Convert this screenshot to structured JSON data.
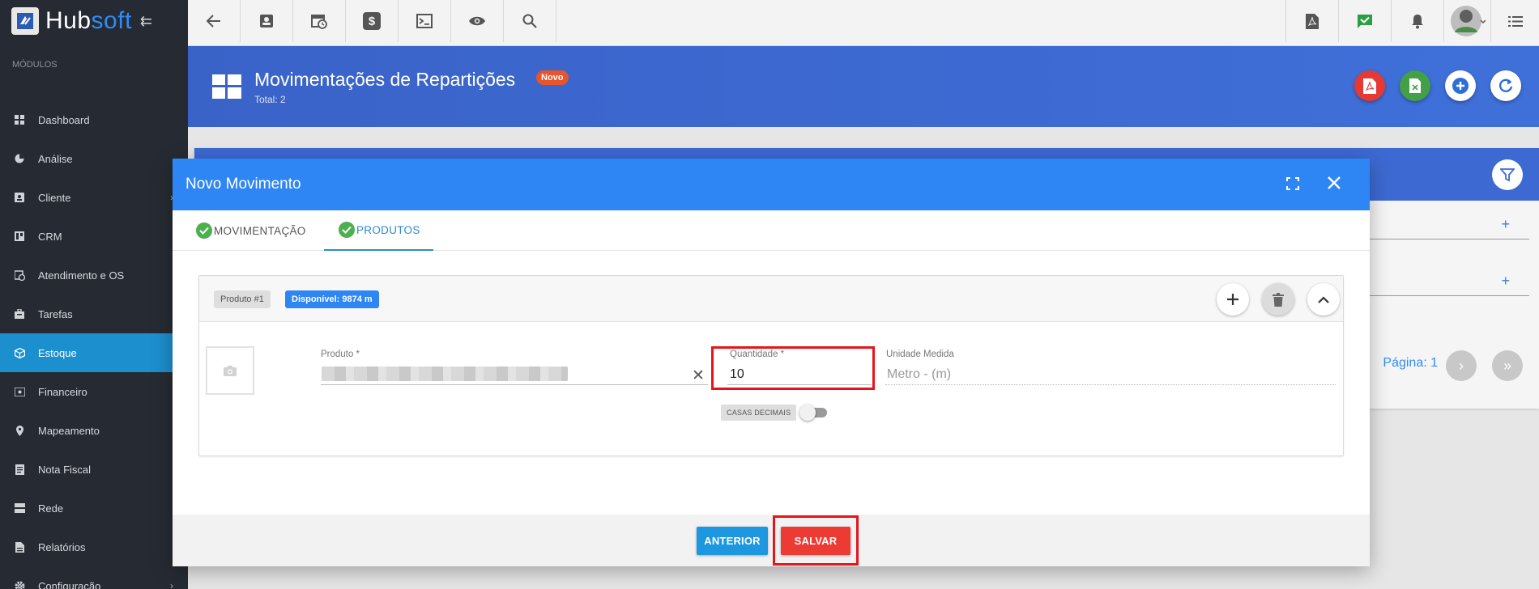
{
  "app": {
    "logo_part1": "Hub",
    "logo_part2": "soft"
  },
  "sidebar": {
    "section_label": "MÓDULOS",
    "items": [
      {
        "label": "Dashboard",
        "icon": "dashboard-icon"
      },
      {
        "label": "Análise",
        "icon": "pie-chart-icon"
      },
      {
        "label": "Cliente",
        "icon": "contact-card-icon",
        "has_submenu": true
      },
      {
        "label": "CRM",
        "icon": "board-icon"
      },
      {
        "label": "Atendimento e OS",
        "icon": "calendar-clock-icon"
      },
      {
        "label": "Tarefas",
        "icon": "briefcase-icon"
      },
      {
        "label": "Estoque",
        "icon": "box-icon",
        "active": true
      },
      {
        "label": "Financeiro",
        "icon": "money-icon"
      },
      {
        "label": "Mapeamento",
        "icon": "map-pin-icon"
      },
      {
        "label": "Nota Fiscal",
        "icon": "document-icon"
      },
      {
        "label": "Rede",
        "icon": "server-icon"
      },
      {
        "label": "Relatórios",
        "icon": "report-icon"
      },
      {
        "label": "Configuração",
        "icon": "gear-icon",
        "has_submenu": true
      }
    ]
  },
  "topbar": {
    "left_buttons": [
      "back-icon",
      "contact-icon",
      "calendar-icon",
      "dollar-icon",
      "terminal-icon",
      "eye-icon",
      "search-icon"
    ],
    "right_buttons": [
      "pdf-icon",
      "chat-check-icon",
      "bell-icon",
      "user-avatar",
      "menu-list-icon"
    ]
  },
  "header": {
    "title": "Movimentações de Repartições",
    "badge": "Novo",
    "subtitle": "Total: 2",
    "actions": [
      {
        "icon": "pdf-icon",
        "color": "#e53935"
      },
      {
        "icon": "spreadsheet-icon",
        "color": "#43a047"
      },
      {
        "icon": "add-icon",
        "color": "#ffffff"
      },
      {
        "icon": "refresh-icon",
        "color": "#ffffff"
      }
    ]
  },
  "background": {
    "pagination_label": "Página: 1"
  },
  "modal": {
    "title": "Novo Movimento",
    "tabs": [
      {
        "label": "MOVIMENTAÇÃO",
        "done": true,
        "active": false
      },
      {
        "label": "PRODUTOS",
        "done": true,
        "active": true
      }
    ],
    "product": {
      "header_label": "Produto #1",
      "available_badge": "Disponível: 9874 m",
      "produto_label": "Produto *",
      "quantidade_label": "Quantidade *",
      "quantidade_value": "10",
      "unidade_label": "Unidade Medida",
      "unidade_value": "Metro - (m)",
      "casas_label": "CASAS DECIMAIS",
      "casas_enabled": false
    },
    "footer": {
      "prev_label": "ANTERIOR",
      "save_label": "SALVAR"
    }
  },
  "colors": {
    "accent_blue": "#2e86f5",
    "sidebar_bg": "#262b33",
    "sidebar_active": "#1c8fce",
    "highlight_red": "#e4161b",
    "save_red": "#ec3b33"
  }
}
